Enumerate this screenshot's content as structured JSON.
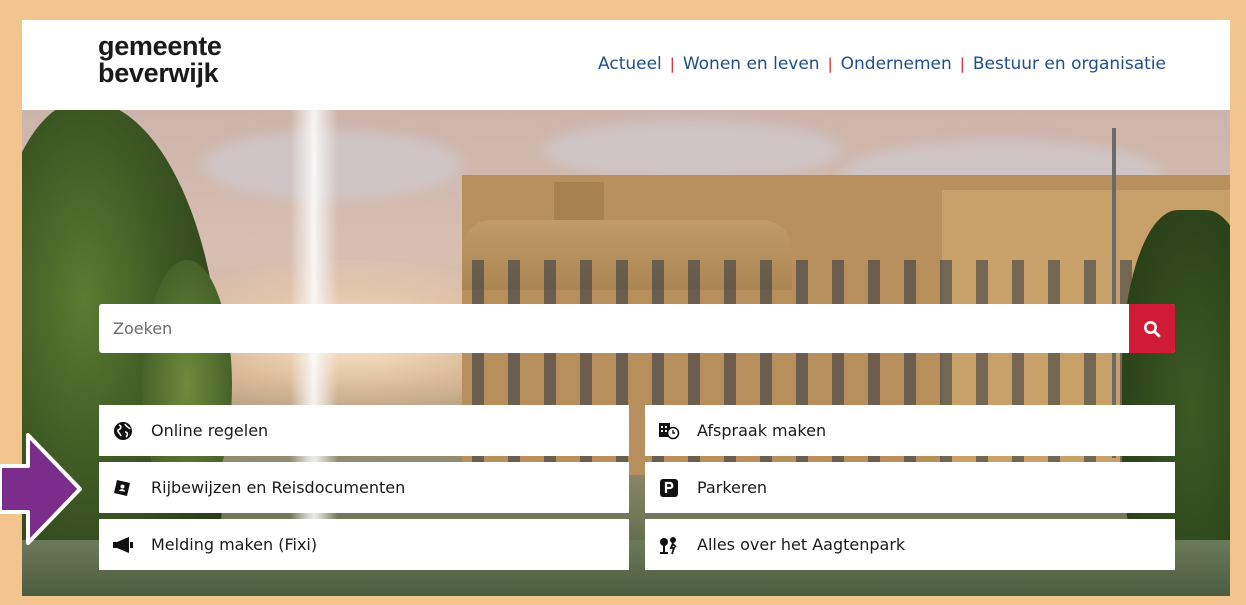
{
  "header": {
    "logo_line1": "gemeente",
    "logo_line2": "beverwijk",
    "nav": [
      {
        "label": "Actueel"
      },
      {
        "label": "Wonen en leven"
      },
      {
        "label": "Ondernemen"
      },
      {
        "label": "Bestuur en organisatie"
      }
    ]
  },
  "search": {
    "placeholder": "Zoeken",
    "button_icon": "search-icon"
  },
  "tiles": [
    {
      "label": "Online regelen",
      "icon": "globe-icon"
    },
    {
      "label": "Afspraak maken",
      "icon": "calendar-clock-icon"
    },
    {
      "label": "Rijbewijzen en Reisdocumenten",
      "icon": "id-card-icon"
    },
    {
      "label": "Parkeren",
      "icon": "parking-icon"
    },
    {
      "label": "Melding maken (Fixi)",
      "icon": "megaphone-icon"
    },
    {
      "label": "Alles over het Aagtenpark",
      "icon": "park-icon"
    }
  ],
  "colors": {
    "border": "#f3c58e",
    "nav_link": "#1f4f8a",
    "nav_separator": "#d41f3a",
    "search_button": "#cf1b36",
    "arrow": "#7b2d8b"
  }
}
